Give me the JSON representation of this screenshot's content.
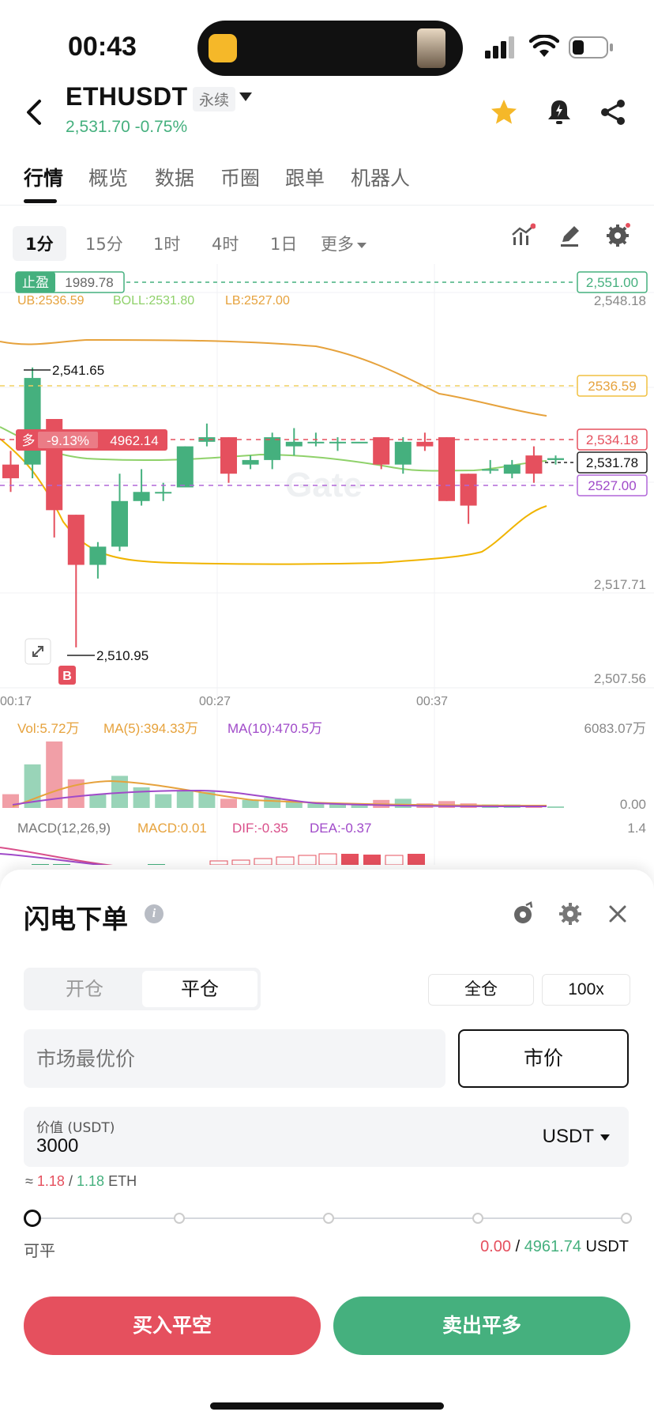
{
  "status_bar": {
    "time": "00:43"
  },
  "header": {
    "pair": "ETHUSDT",
    "contract_tag": "永续",
    "price": "2,531.70",
    "change": "-0.75%",
    "icons": [
      "back-icon",
      "star-icon",
      "alert-bell-icon",
      "share-icon"
    ],
    "colors": {
      "price_green": "#45b07e",
      "star": "#f5b829"
    }
  },
  "tabs": [
    "行情",
    "概览",
    "数据",
    "币圈",
    "跟单",
    "机器人"
  ],
  "active_tab": "行情",
  "intervals": [
    "1分",
    "15分",
    "1时",
    "4时",
    "1日",
    "更多"
  ],
  "active_interval": "1分",
  "chart": {
    "tp_label": "止盈",
    "tp_value": "1989.78",
    "indicator": {
      "ub": "UB:2536.59",
      "boll": "BOLL:2531.80",
      "lb": "LB:2527.00"
    },
    "position": {
      "side": "多",
      "pnl": "-9.13%",
      "entry": "4962.14"
    },
    "price_tags": {
      "tp_line": "2,551.00",
      "ub": "2536.59",
      "position_line": "2,534.18",
      "last": "2,531.78",
      "lb": "2527.00"
    },
    "y_labels": {
      "top": "2,548.18",
      "mid": "2,517.71",
      "bottom": "2,507.56"
    },
    "high_marker": "2,541.65",
    "low_marker": "2,510.95",
    "buy_marker": "B",
    "time_labels": [
      "00:17",
      "00:27",
      "00:37"
    ],
    "volume": {
      "vol": "Vol:5.72万",
      "ma5": "MA(5):394.33万",
      "ma10": "MA(10):470.5万",
      "max": "6083.07万",
      "zero": "0.00"
    },
    "macd": {
      "params": "MACD(12,26,9)",
      "macd": "MACD:0.01",
      "dif": "DIF:-0.35",
      "dea": "DEA:-0.37",
      "max": "1.4"
    },
    "watermark": "Gate",
    "colors": {
      "up": "#45b07e",
      "down": "#e5505e",
      "ub_band": "#e6a23c",
      "boll_mid": "#8fd16a",
      "lb_band": "#f0b400",
      "dif": "#d94f8a",
      "dea": "#a04ac9"
    }
  },
  "chart_data": {
    "type": "candlestick",
    "time_labels": [
      "00:17",
      "00:27",
      "00:37"
    ],
    "candles": [
      {
        "open": 2531.0,
        "close": 2529.5,
        "high": 2532.5,
        "low": 2528.0
      },
      {
        "open": 2531.0,
        "close": 2540.5,
        "high": 2541.65,
        "low": 2529.5
      },
      {
        "open": 2536.0,
        "close": 2526.0,
        "high": 2536.0,
        "low": 2523.0
      },
      {
        "open": 2525.5,
        "close": 2520.0,
        "high": 2525.5,
        "low": 2510.95
      },
      {
        "open": 2520.0,
        "close": 2522.0,
        "high": 2522.5,
        "low": 2518.5
      },
      {
        "open": 2522.0,
        "close": 2527.0,
        "high": 2530.0,
        "low": 2521.5
      },
      {
        "open": 2527.0,
        "close": 2528.0,
        "high": 2530.5,
        "low": 2526.5
      },
      {
        "open": 2528.0,
        "close": 2528.0,
        "high": 2529.0,
        "low": 2527.0
      },
      {
        "open": 2528.5,
        "close": 2533.0,
        "high": 2533.0,
        "low": 2528.5
      },
      {
        "open": 2533.5,
        "close": 2534.0,
        "high": 2535.5,
        "low": 2533.0
      },
      {
        "open": 2534.0,
        "close": 2530.0,
        "high": 2534.0,
        "low": 2529.0
      },
      {
        "open": 2531.0,
        "close": 2531.5,
        "high": 2532.0,
        "low": 2530.5
      },
      {
        "open": 2531.5,
        "close": 2534.0,
        "high": 2534.5,
        "low": 2530.5
      },
      {
        "open": 2533.0,
        "close": 2533.5,
        "high": 2535.0,
        "low": 2532.0
      },
      {
        "open": 2533.5,
        "close": 2533.5,
        "high": 2534.5,
        "low": 2533.0
      },
      {
        "open": 2533.5,
        "close": 2533.5,
        "high": 2534.0,
        "low": 2532.5
      },
      {
        "open": 2533.5,
        "close": 2533.5,
        "high": 2533.5,
        "low": 2533.5
      },
      {
        "open": 2534.0,
        "close": 2531.0,
        "high": 2534.0,
        "low": 2530.5
      },
      {
        "open": 2531.0,
        "close": 2533.5,
        "high": 2534.0,
        "low": 2530.0
      },
      {
        "open": 2533.5,
        "close": 2533.0,
        "high": 2534.5,
        "low": 2532.5
      },
      {
        "open": 2534.0,
        "close": 2527.0,
        "high": 2534.0,
        "low": 2527.0
      },
      {
        "open": 2530.0,
        "close": 2526.5,
        "high": 2530.0,
        "low": 2524.5
      },
      {
        "open": 2530.5,
        "close": 2530.5,
        "high": 2531.5,
        "low": 2530.0
      },
      {
        "open": 2530.0,
        "close": 2531.0,
        "high": 2531.5,
        "low": 2529.5
      },
      {
        "open": 2532.0,
        "close": 2530.0,
        "high": 2533.0,
        "low": 2529.0
      },
      {
        "open": 2531.5,
        "close": 2531.7,
        "high": 2532.0,
        "low": 2531.0
      }
    ],
    "volume": [
      12,
      38,
      58,
      25,
      12,
      28,
      18,
      12,
      15,
      14,
      8,
      7,
      9,
      6,
      4,
      4,
      4,
      7,
      8,
      4,
      6,
      4,
      3,
      3,
      2,
      1
    ],
    "ylim": [
      2507.56,
      2551.0
    ]
  },
  "panel": {
    "title": "闪电下单",
    "icons": [
      "info-icon",
      "history-icon",
      "settings-icon",
      "close-icon"
    ],
    "mode_tabs": [
      "开仓",
      "平仓"
    ],
    "active_mode": "平仓",
    "margin_mode": "全仓",
    "leverage": "100x",
    "price_placeholder": "市场最优价",
    "market_button": "市价",
    "value_label": "价值 (USDT)",
    "value_input": "3000",
    "unit": "USDT",
    "approx_prefix": "≈",
    "approx_red": "1.18",
    "approx_sep": "/",
    "approx_green": "1.18",
    "approx_unit": "ETH",
    "slider_percent": 0,
    "available_label": "可平",
    "available_red": "0.00",
    "available_green": "4961.74",
    "available_unit": "USDT",
    "buy_button": "买入平空",
    "sell_button": "卖出平多",
    "colors": {
      "buy": "#e5505e",
      "sell": "#45b07e"
    }
  }
}
